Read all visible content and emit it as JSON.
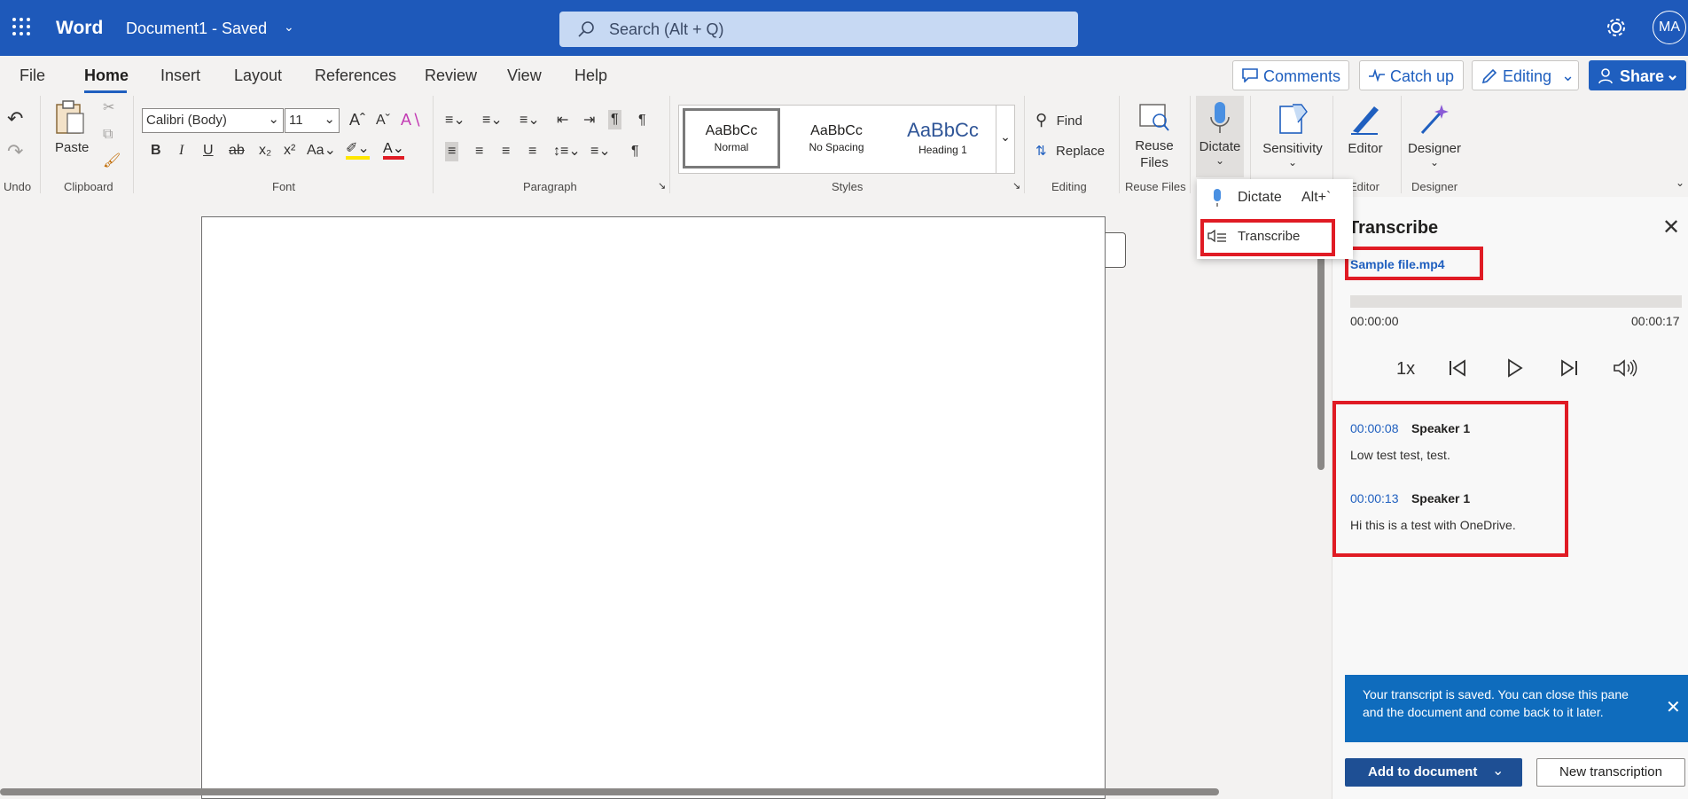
{
  "titlebar": {
    "app_name": "Word",
    "doc_title": "Document1 - Saved",
    "search_placeholder": "Search (Alt + Q)",
    "avatar_initials": "MA"
  },
  "tabs": [
    "File",
    "Home",
    "Insert",
    "Layout",
    "References",
    "Review",
    "View",
    "Help"
  ],
  "top_buttons": {
    "comments": "Comments",
    "catchup": "Catch up",
    "editing": "Editing",
    "share": "Share"
  },
  "ribbon": {
    "undo_label": "Undo",
    "clipboard_label": "Clipboard",
    "paste": "Paste",
    "font_name": "Calibri (Body)",
    "font_size": "11",
    "font_label": "Font",
    "paragraph_label": "Paragraph",
    "styles_label": "Styles",
    "styles": [
      {
        "sample": "AaBbCc",
        "name": "Normal"
      },
      {
        "sample": "AaBbCc",
        "name": "No Spacing"
      },
      {
        "sample": "AaBbCc",
        "name": "Heading 1"
      }
    ],
    "find": "Find",
    "replace": "Replace",
    "editing_label": "Editing",
    "reuse_files": "Reuse Files",
    "reuse_files_label": "Reuse Files",
    "dictate": "Dictate",
    "sensitivity": "Sensitivity",
    "editor": "Editor",
    "editor_label": "Editor",
    "designer": "Designer",
    "designer_label": "Designer"
  },
  "dictate_menu": {
    "dictate": "Dictate",
    "dictate_shortcut": "Alt+`",
    "transcribe": "Transcribe"
  },
  "pane": {
    "title": "Transcribe",
    "file_name": "Sample file.mp4",
    "time_start": "00:00:00",
    "time_end": "00:00:17",
    "speed": "1x",
    "entries": [
      {
        "time": "00:00:08",
        "speaker": "Speaker 1",
        "text": "Low test test, test."
      },
      {
        "time": "00:00:13",
        "speaker": "Speaker 1",
        "text": "Hi this is a test with OneDrive."
      }
    ],
    "toast": "Your transcript is saved. You can close this pane and the document and come back to it later.",
    "add_to_document": "Add to document",
    "new_transcription": "New transcription"
  },
  "colors": {
    "titlebar": "#1e59ba",
    "accent": "#1f5fbf",
    "highlight_red": "#e01b24",
    "toast": "#0f6cbd"
  }
}
